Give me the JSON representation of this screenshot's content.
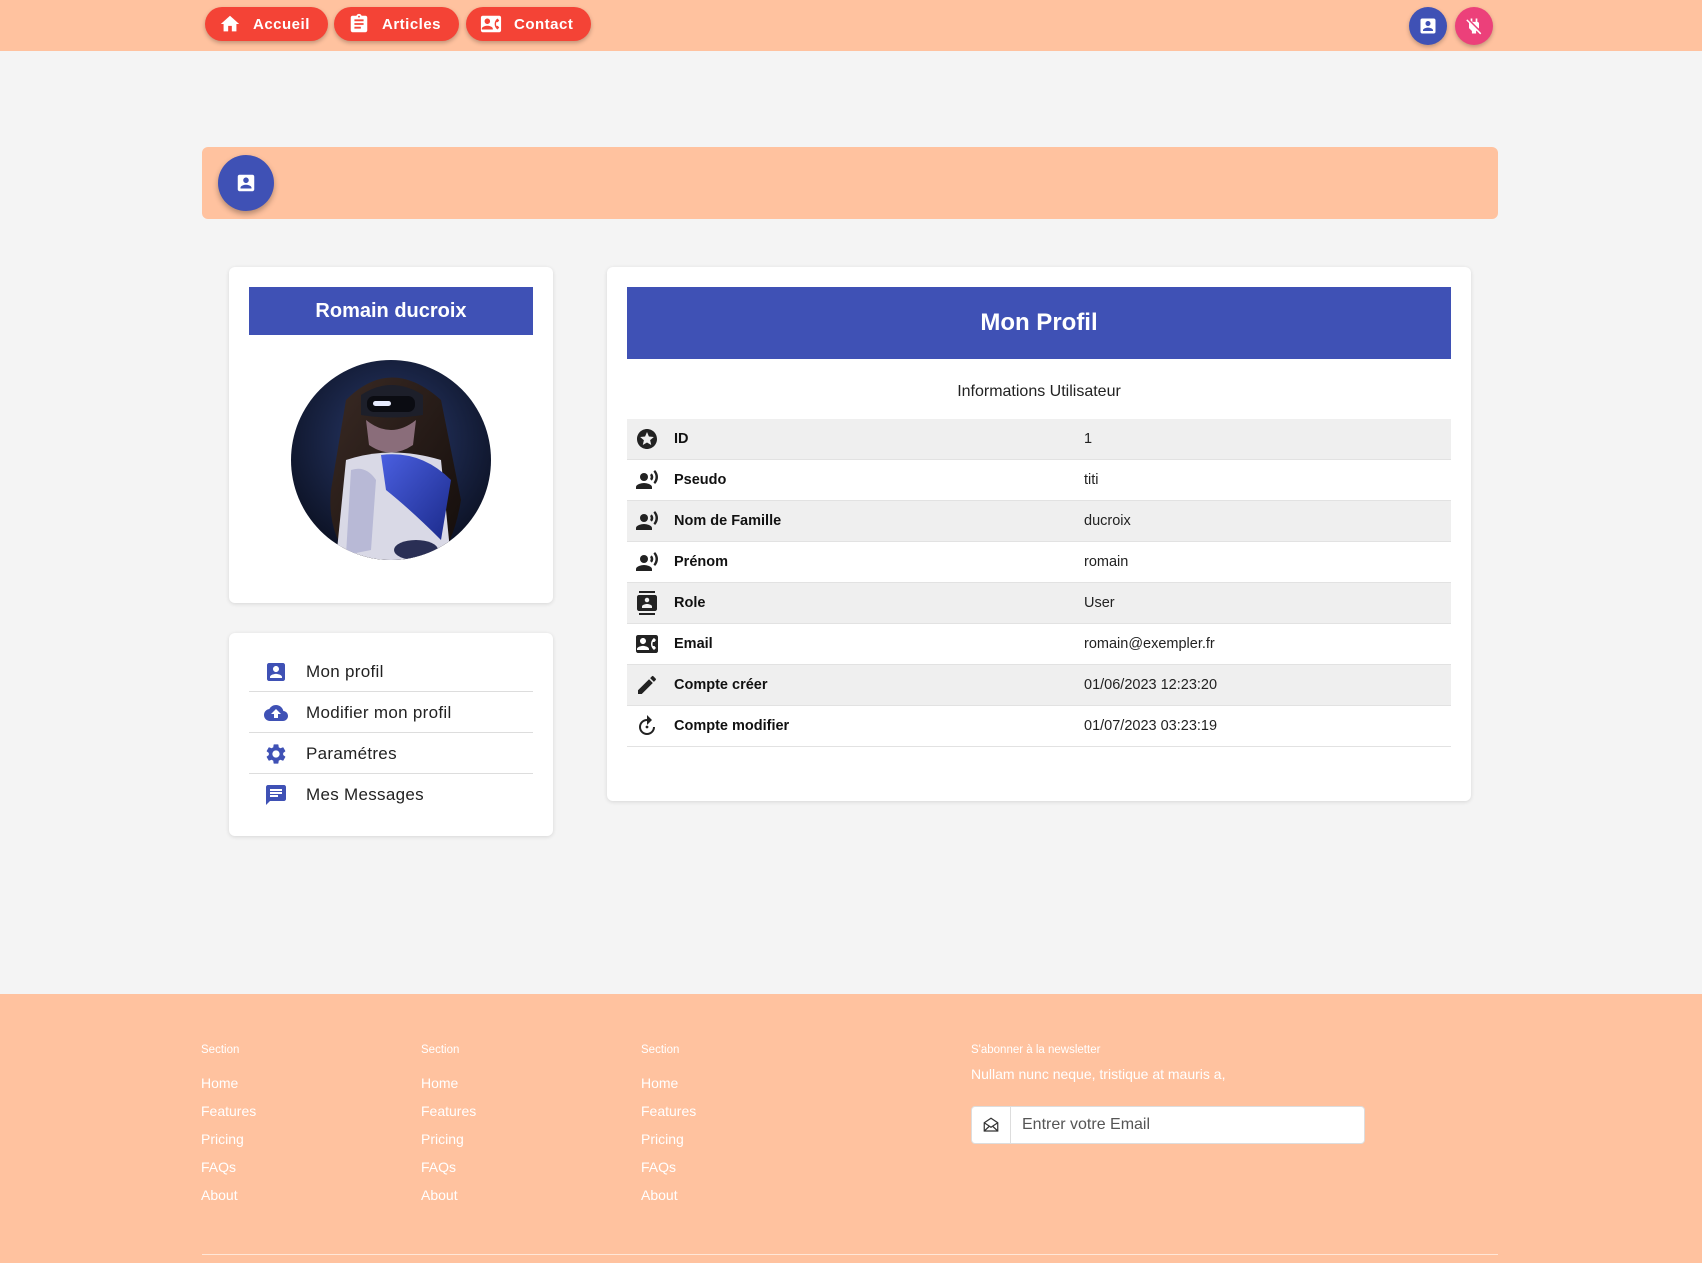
{
  "nav": {
    "items": [
      {
        "label": "Accueil",
        "icon": "home-icon"
      },
      {
        "label": "Articles",
        "icon": "clipboard-icon"
      },
      {
        "label": "Contact",
        "icon": "contact-card-icon"
      }
    ],
    "right_buttons": [
      {
        "icon": "account-box-icon",
        "color": "#3f51b5"
      },
      {
        "icon": "power-off-icon",
        "color": "#ec407a"
      }
    ],
    "accent_color": "#f44336"
  },
  "banner": {
    "icon": "account-box-icon",
    "color": "#ffc29f"
  },
  "user_card": {
    "name": "Romain ducroix",
    "avatar": "vr-headset-person-photo"
  },
  "side_menu": {
    "items": [
      {
        "label": "Mon profil",
        "icon": "account-box-icon"
      },
      {
        "label": "Modifier mon profil",
        "icon": "cloud-upload-icon"
      },
      {
        "label": "Paramétres",
        "icon": "gear-icon"
      },
      {
        "label": "Mes Messages",
        "icon": "message-icon"
      }
    ]
  },
  "profile": {
    "title": "Mon Profil",
    "subtitle": "Informations Utilisateur",
    "rows": [
      {
        "icon": "star-circle-icon",
        "label": "ID",
        "value": "1"
      },
      {
        "icon": "voice-person-icon",
        "label": "Pseudo",
        "value": "titi"
      },
      {
        "icon": "voice-person-icon",
        "label": "Nom de Famille",
        "value": "ducroix"
      },
      {
        "icon": "voice-person-icon",
        "label": "Prénom",
        "value": "romain"
      },
      {
        "icon": "contact-book-icon",
        "label": "Role",
        "value": "User"
      },
      {
        "icon": "contact-card-icon",
        "label": "Email",
        "value": "romain@exempler.fr"
      },
      {
        "icon": "pencil-icon",
        "label": "Compte créer",
        "value": "01/06/2023 12:23:20"
      },
      {
        "icon": "refresh-icon",
        "label": "Compte modifier",
        "value": "01/07/2023 03:23:19"
      }
    ]
  },
  "footer": {
    "columns": [
      {
        "heading": "Section",
        "links": [
          "Home",
          "Features",
          "Pricing",
          "FAQs",
          "About"
        ]
      },
      {
        "heading": "Section",
        "links": [
          "Home",
          "Features",
          "Pricing",
          "FAQs",
          "About"
        ]
      },
      {
        "heading": "Section",
        "links": [
          "Home",
          "Features",
          "Pricing",
          "FAQs",
          "About"
        ]
      }
    ],
    "newsletter": {
      "heading": "S'abonner à la newsletter",
      "text": "Nullam nunc neque, tristique at mauris a,",
      "placeholder": "Entrer votre Email",
      "icon": "envelope-icon"
    },
    "color": "#ffc29f"
  },
  "colors": {
    "primary": "#3f51b5",
    "nav_button": "#f44336",
    "logout": "#ec407a",
    "peach": "#ffc29f"
  }
}
